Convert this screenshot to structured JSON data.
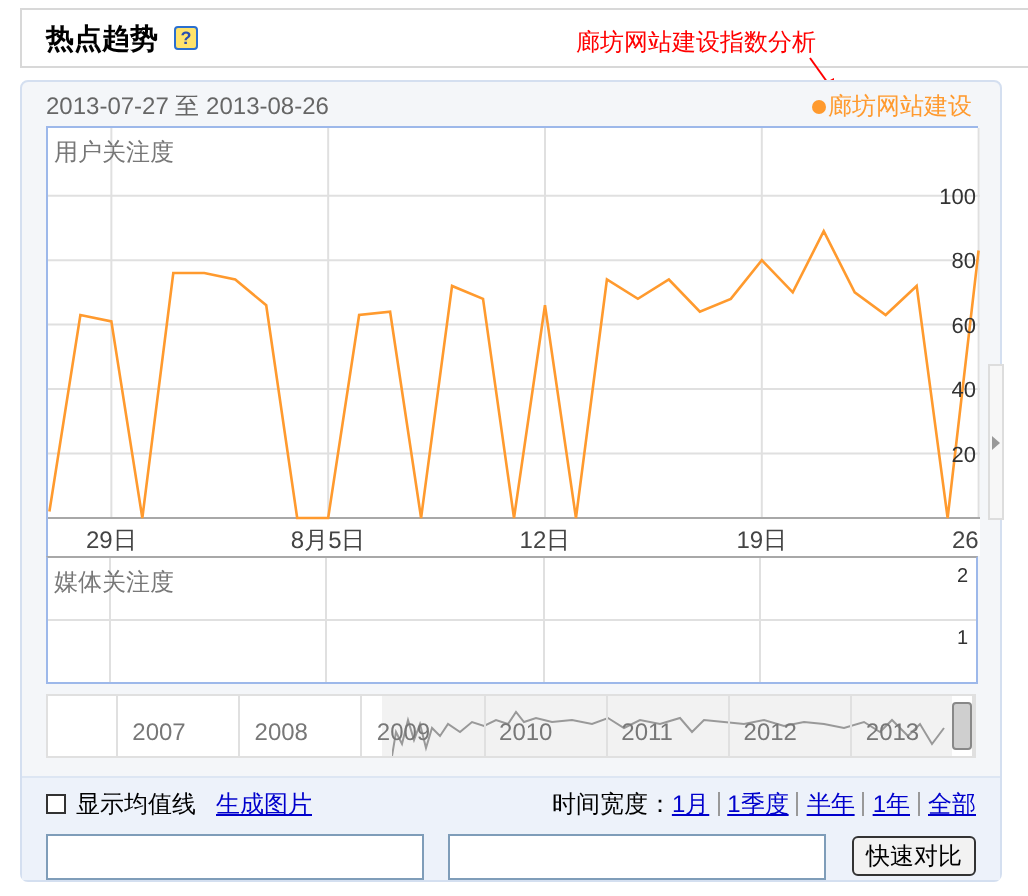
{
  "header": {
    "title": "热点趋势",
    "help_icon": "?",
    "annotation": "廊坊网站建设指数分析"
  },
  "panel": {
    "date_range": "2013-07-27 至 2013-08-26",
    "user_chart": {
      "chart_data": {
        "type": "line",
        "title": "用户关注度",
        "categories": [
          null,
          null,
          "29日",
          null,
          null,
          null,
          null,
          null,
          null,
          "8月5日",
          null,
          null,
          null,
          null,
          null,
          null,
          "12日",
          null,
          null,
          null,
          null,
          null,
          null,
          "19日",
          null,
          null,
          null,
          null,
          null,
          null,
          "26"
        ],
        "series": [
          {
            "name": "廊坊网站建设",
            "color": "#ff9a2e",
            "values": [
              2,
              63,
              61,
              0,
              76,
              76,
              74,
              66,
              0,
              0,
              63,
              64,
              0,
              72,
              68,
              0,
              66,
              0,
              74,
              68,
              74,
              64,
              68,
              80,
              70,
              89,
              70,
              63,
              72,
              0,
              83
            ]
          }
        ],
        "ylim": [
          0,
          121
        ],
        "yticks": [
          20,
          40,
          60,
          80,
          100
        ],
        "grid": true
      }
    },
    "media_chart": {
      "title": "媒体关注度",
      "y_labels": [
        "2",
        "1"
      ]
    },
    "timeline": {
      "level": 1,
      "years": [
        "2007",
        "2008",
        "2009",
        "2010",
        "2011",
        "2012",
        "2013"
      ]
    }
  },
  "controls": {
    "average_line": {
      "label": "显示均值线",
      "checked": false
    },
    "image_link": "生成图片",
    "width_label": "时间宽度：",
    "ranges": [
      "1月",
      "1季度",
      "半年",
      "1年",
      "全部"
    ],
    "compare_button": "快速对比"
  }
}
